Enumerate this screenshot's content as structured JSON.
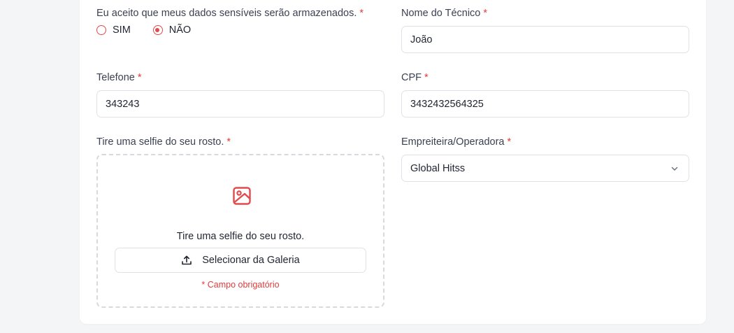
{
  "form": {
    "consent": {
      "label": "Eu aceito que meus dados sensíveis serão armazenados.",
      "required_mark": "*",
      "options": [
        {
          "label": "SIM",
          "checked": false
        },
        {
          "label": "NÃO",
          "checked": true
        }
      ]
    },
    "technician_name": {
      "label": "Nome do Técnico",
      "required_mark": "*",
      "value": "João"
    },
    "phone": {
      "label": "Telefone",
      "required_mark": "*",
      "value": "343243"
    },
    "cpf": {
      "label": "CPF",
      "required_mark": "*",
      "value": "3432432564325"
    },
    "selfie": {
      "label": "Tire uma selfie do seu rosto.",
      "required_mark": "*",
      "icon": "image-icon",
      "prompt": "Tire uma selfie do seu rosto.",
      "gallery_button_label": "Selecionar da Galeria",
      "gallery_button_icon": "upload-icon",
      "error": "* Campo obrigatório"
    },
    "contractor": {
      "label": "Empreiteira/Operadora",
      "required_mark": "*",
      "selected": "Global Hitss",
      "icon": "chevron-down-icon"
    }
  },
  "colors": {
    "accent": "#e24b4b",
    "required": "#e03c3c",
    "border": "#dfe2e7"
  }
}
